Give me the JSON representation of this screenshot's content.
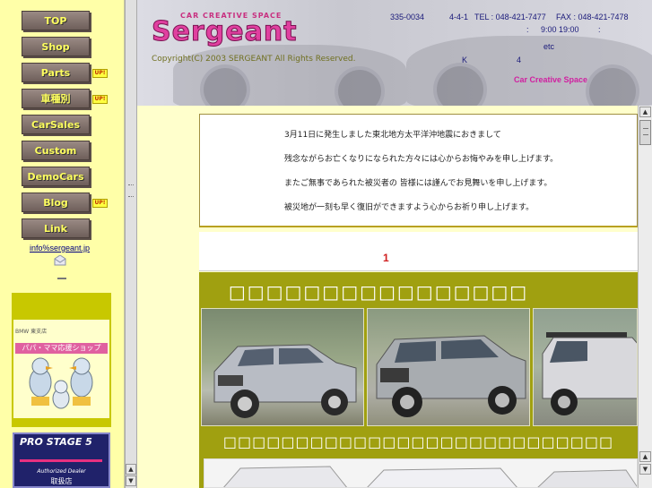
{
  "nav": {
    "items": [
      {
        "label": "TOP",
        "up": false
      },
      {
        "label": "Shop",
        "up": false
      },
      {
        "label": "Parts",
        "up": true
      },
      {
        "label": "車種別",
        "up": true
      },
      {
        "label": "CarSales",
        "up": false
      },
      {
        "label": "Custom",
        "up": false
      },
      {
        "label": "DemoCars",
        "up": false
      },
      {
        "label": "Blog",
        "up": true
      },
      {
        "label": "Link",
        "up": false
      }
    ],
    "up_badge": "UP!",
    "email": "info%sergeant.jp"
  },
  "banners": {
    "papa_header": "BMW 東支店",
    "papa_title": "パパ・ママ応援ショップ",
    "prostage_name": "PRO STAGE 5",
    "prostage_dealer": "Authorized Dealer",
    "prostage_shop": "取扱店"
  },
  "header": {
    "logo_sub": "CAR CREATIVE SPACE",
    "logo": "Sergeant",
    "copyright": "Copyright(C) 2003 SERGEANT All Rights Reserved.",
    "postal": "335-0034",
    "address_num": "4-4-1",
    "tel": "TEL : 048-421-7477",
    "fax": "FAX : 048-421-7478",
    "hours_sep1": ":",
    "hours": "9:00 19:00",
    "hours_sep2": ":",
    "etc": "etc",
    "k": "K",
    "four": "4",
    "tagline": "Car Creative Space"
  },
  "message": {
    "line1": "3月11日に発生しました東北地方太平洋沖地震におきまして",
    "line2": "残念ながらお亡くなりになられた方々には心からお悔やみを申し上げます。",
    "line3": "またご無事であられた被災者の 皆様には謹んでお見舞いを申し上げます。",
    "line4": "被災地が一刻も早く復旧ができますよう心からお祈り申し上げます。"
  },
  "feature": {
    "number": "1",
    "title": "□□□□□□□□□□□□□□□□",
    "caption": "□□□□□□□□□□□□□□□□□□□□□□□□□□□"
  },
  "colors": {
    "nav_bg": "#ffffa8",
    "olive": "#a0a010",
    "logo_pink": "#e040a0"
  }
}
